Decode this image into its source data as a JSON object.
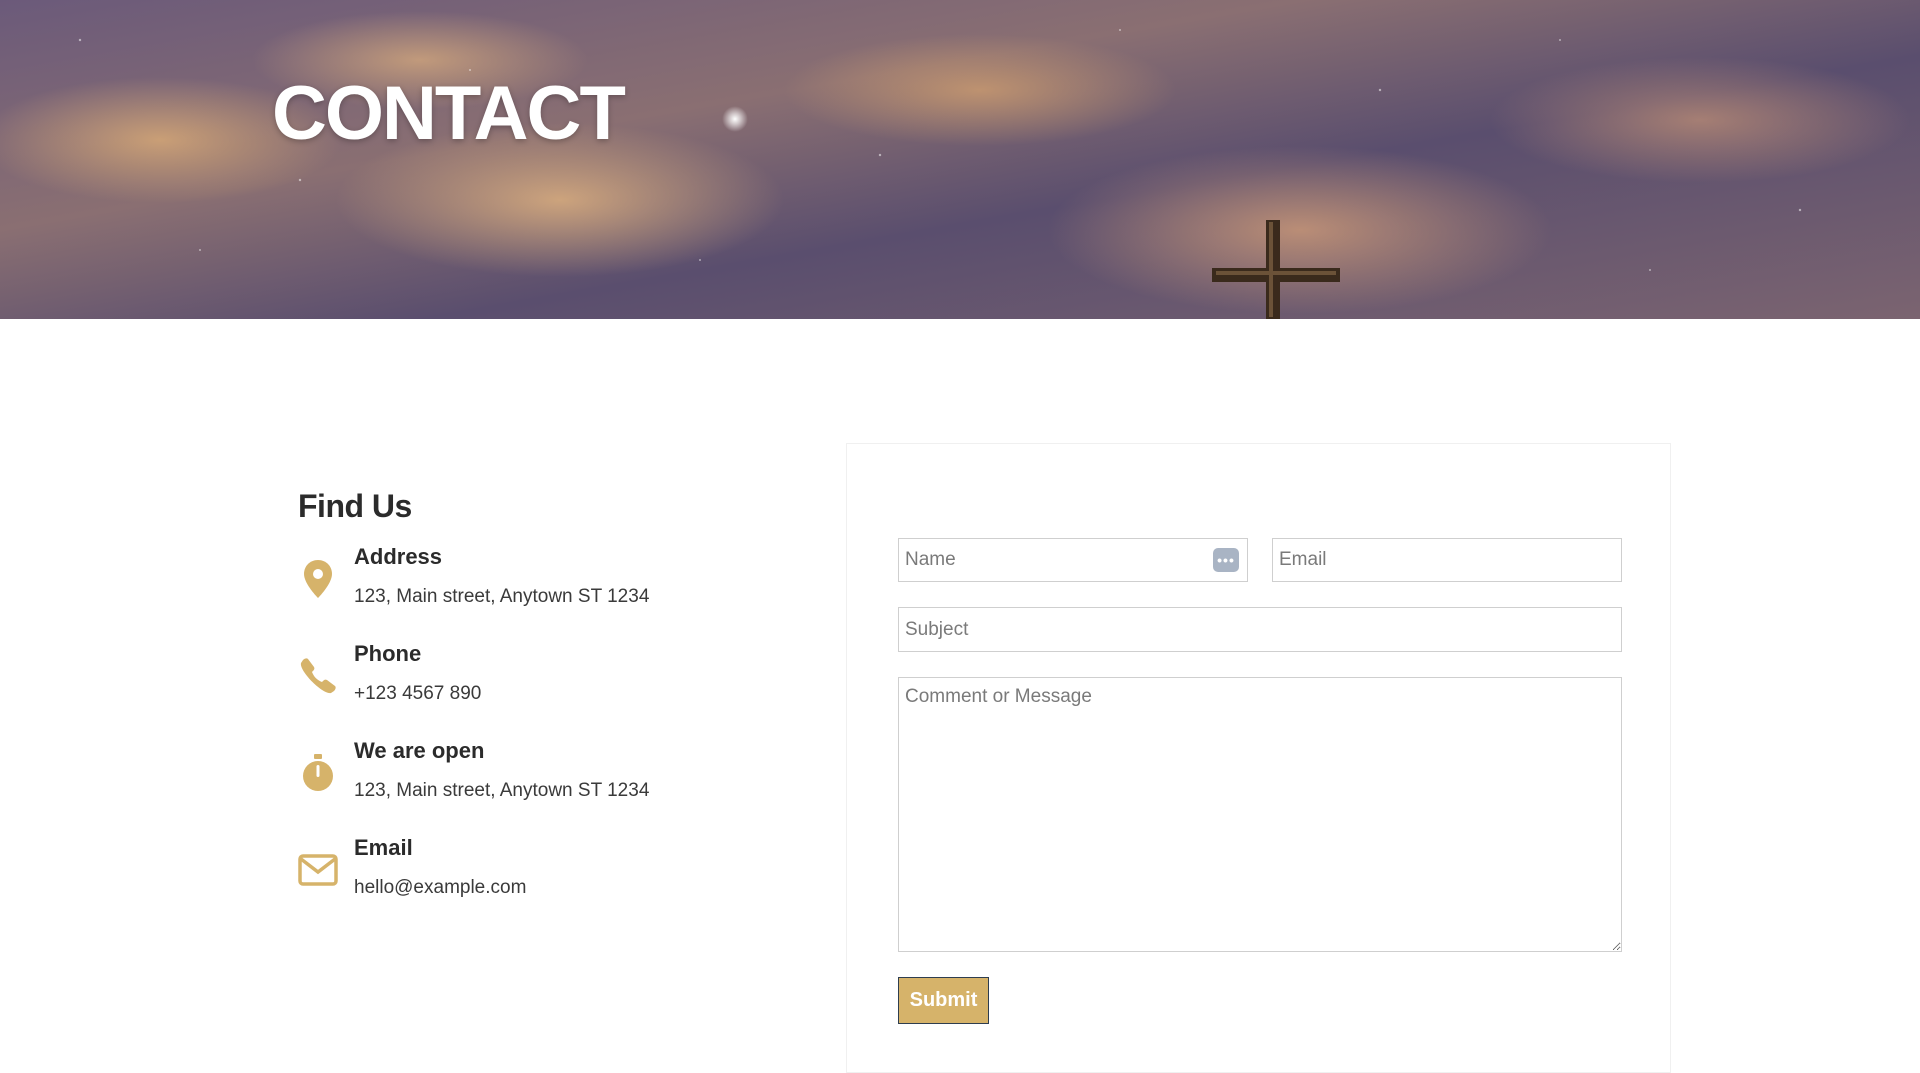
{
  "hero": {
    "title": "CONTACT"
  },
  "find_us": {
    "heading": "Find Us",
    "items": [
      {
        "icon": "map-pin-icon",
        "label": "Address",
        "value": "123, Main street, Anytown ST 1234"
      },
      {
        "icon": "phone-icon",
        "label": "Phone",
        "value": "+123 4567 890"
      },
      {
        "icon": "stopwatch-icon",
        "label": "We are open",
        "value": "123, Main street, Anytown ST 1234"
      },
      {
        "icon": "envelope-icon",
        "label": "Email",
        "value": "hello@example.com"
      }
    ]
  },
  "form": {
    "name_placeholder": "Name",
    "email_placeholder": "Email",
    "subject_placeholder": "Subject",
    "message_placeholder": "Comment or Message",
    "submit_label": "Submit"
  },
  "colors": {
    "accent": "#d6b36a",
    "text": "#2b2b2b"
  }
}
